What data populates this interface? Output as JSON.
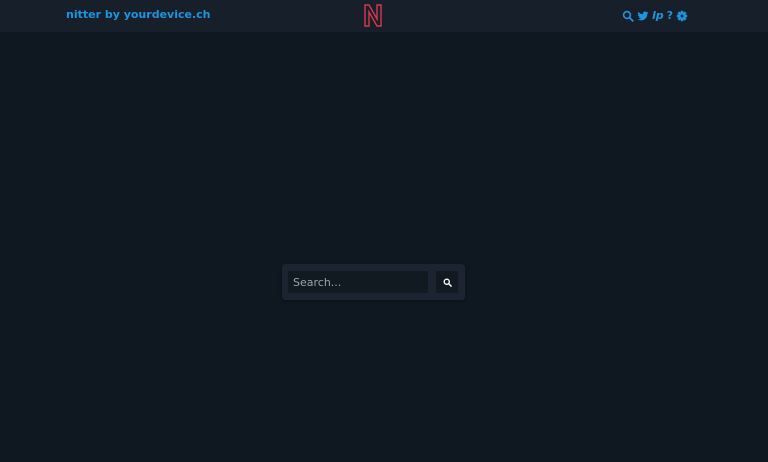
{
  "navbar": {
    "brand": "nitter by yourdevice.ch",
    "logo_letter": "N",
    "icons": [
      "search-icon",
      "twitter-bird-icon",
      "rss-icon",
      "help-icon",
      "gear-icon"
    ],
    "rss_label": "lp",
    "help_label": "?"
  },
  "search": {
    "placeholder": "Search...",
    "value": "",
    "button_icon": "search-icon"
  },
  "colors": {
    "background": "#0f1721",
    "navbar": "#161f2a",
    "accent": "#1c95de",
    "logo": "#d9384b",
    "panel": "#1b2430",
    "input": "#111921"
  }
}
